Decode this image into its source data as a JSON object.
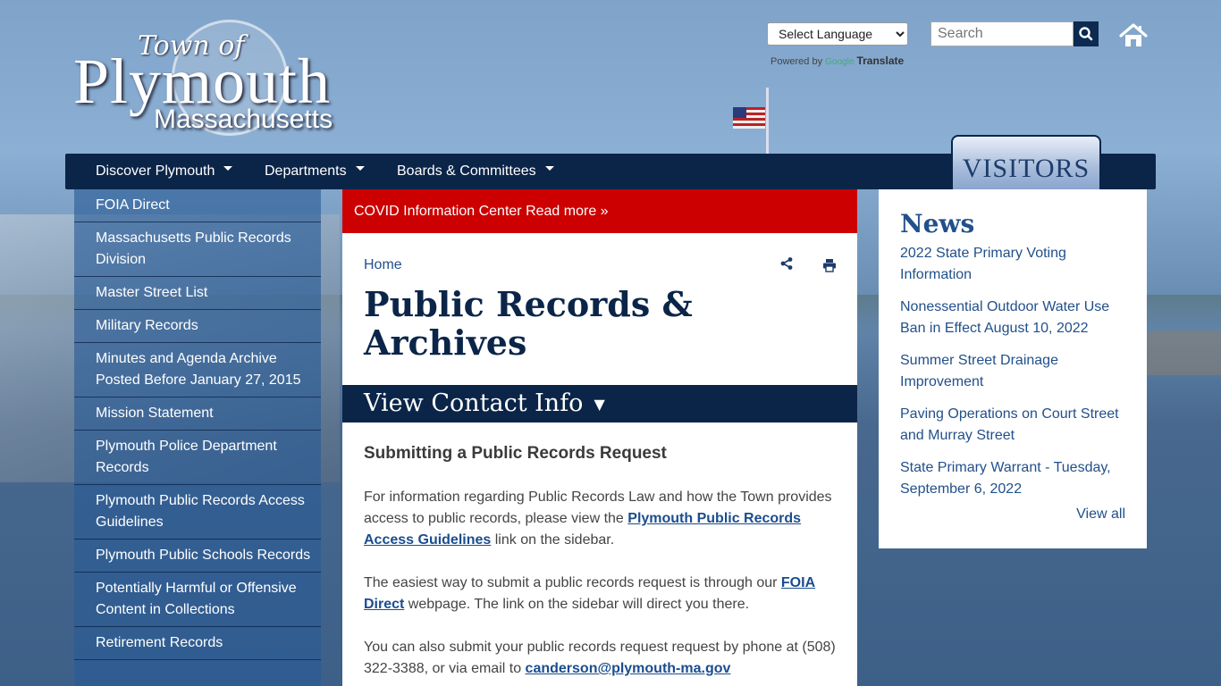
{
  "logo": {
    "town_of": "Town of",
    "name": "Plymouth",
    "state": "Massachusetts"
  },
  "language": {
    "selected": "Select Language",
    "powered_by": "Powered by",
    "google": "Google",
    "translate": "Translate"
  },
  "search": {
    "placeholder": "Search"
  },
  "nav": {
    "items": [
      {
        "label": "Discover Plymouth"
      },
      {
        "label": "Departments"
      },
      {
        "label": "Boards & Committees"
      }
    ],
    "visitors_label": "VISITORS"
  },
  "sidebar": {
    "items": [
      {
        "label": "FOIA Direct"
      },
      {
        "label": "Massachusetts Public Records Division"
      },
      {
        "label": "Master Street List"
      },
      {
        "label": "Military Records"
      },
      {
        "label": "Minutes and Agenda Archive Posted Before January 27, 2015"
      },
      {
        "label": "Mission Statement"
      },
      {
        "label": "Plymouth Police Department Records"
      },
      {
        "label": "Plymouth Public Records Access Guidelines"
      },
      {
        "label": "Plymouth Public Schools Records"
      },
      {
        "label": "Potentially Harmful or Offensive Content in Collections"
      },
      {
        "label": "Retirement Records"
      }
    ]
  },
  "banner": {
    "text": "COVID Information Center Read more »"
  },
  "main": {
    "breadcrumb": "Home",
    "title": "Public Records & Archives",
    "contact_label": "View Contact Info",
    "contact_caret": "▼",
    "heading": "Submitting a Public Records Request",
    "p1_before": "For information regarding Public Records Law and how the Town provides access to public records, please view the ",
    "p1_link": "Plymouth Public Records Access Guidelines",
    "p1_after": " link on the sidebar.",
    "p2_before": "The easiest way to submit a public records request is through our ",
    "p2_link": "FOIA Direct",
    "p2_after": " webpage. The link on the sidebar will direct you there.",
    "p3_before": "You can also submit your public records request request by phone at (508) 322-3388, or via email to ",
    "p3_link": "canderson@plymouth-ma.gov"
  },
  "news": {
    "title": "News",
    "items": [
      {
        "label": "2022 State Primary Voting Information"
      },
      {
        "label": "Nonessential Outdoor Water Use Ban in Effect August 10, 2022"
      },
      {
        "label": "Summer Street Drainage Improvement"
      },
      {
        "label": "Paving Operations on Court Street and Murray Street"
      },
      {
        "label": "State Primary Warrant - Tuesday, September 6, 2022"
      }
    ],
    "view_all": "View all"
  }
}
